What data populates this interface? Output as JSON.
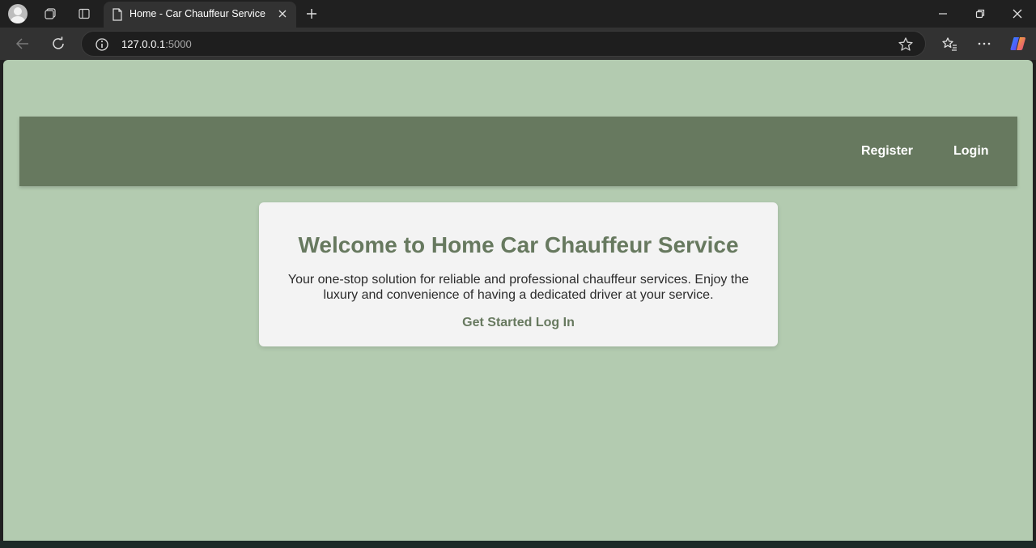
{
  "browser": {
    "tab_title": "Home - Car Chauffeur Service",
    "url_host": "127.0.0.1",
    "url_port": ":5000"
  },
  "site": {
    "nav": {
      "register": "Register",
      "login": "Login"
    },
    "hero": {
      "title": "Welcome to Home Car Chauffeur Service",
      "line1": "Your one-stop solution for reliable and professional chauffeur services. Enjoy the",
      "line2": "luxury and convenience of having a dedicated driver at your service.",
      "get_started": "Get Started",
      "log_in": "Log In"
    }
  },
  "colors": {
    "page_bg": "#b3cbb0",
    "header_bg": "#67795f",
    "card_bg": "#f3f3f3",
    "accent_text": "#67795f"
  }
}
